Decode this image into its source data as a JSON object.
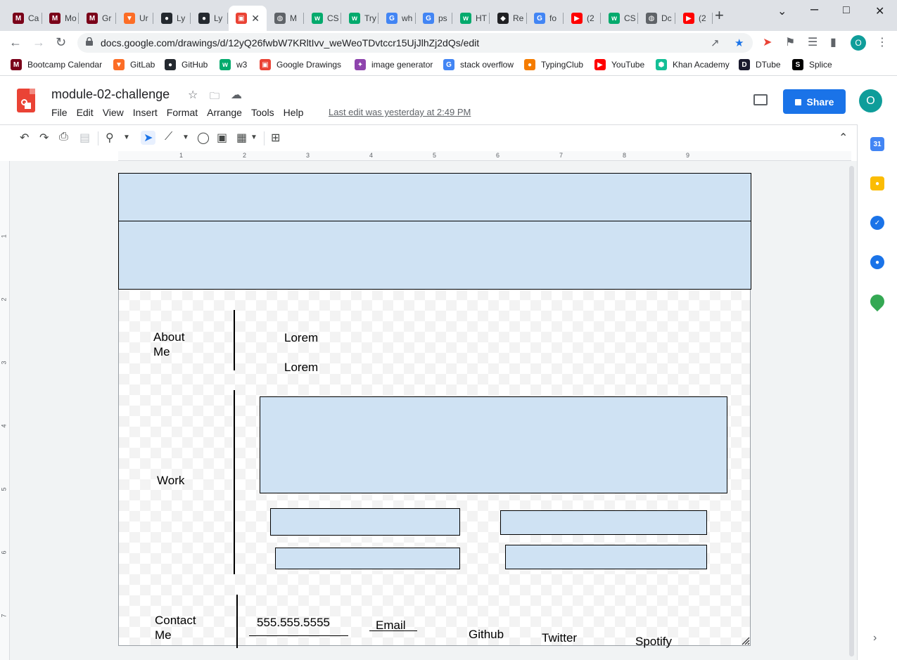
{
  "browser": {
    "tabs": [
      {
        "label": "Ca",
        "icon": "umn-icon",
        "color": "#7a0019",
        "glyph": "M"
      },
      {
        "label": "Mo",
        "icon": "umn-icon",
        "color": "#7a0019",
        "glyph": "M"
      },
      {
        "label": "Gr",
        "icon": "umn-icon",
        "color": "#7a0019",
        "glyph": "M"
      },
      {
        "label": "Ur",
        "icon": "gitlab-icon",
        "color": "#fc6d26",
        "glyph": "▼"
      },
      {
        "label": "Ly",
        "icon": "github-icon",
        "color": "#24292f",
        "glyph": "●"
      },
      {
        "label": "Ly",
        "icon": "github-icon",
        "color": "#24292f",
        "glyph": "●"
      },
      {
        "label": "",
        "icon": "drawings-icon",
        "color": "#ea4335",
        "glyph": "▣",
        "active": true
      },
      {
        "label": "M",
        "icon": "globe-icon",
        "color": "#5f6368",
        "glyph": "◍"
      },
      {
        "label": "CS",
        "icon": "w3-icon",
        "color": "#04aa6d",
        "glyph": "w"
      },
      {
        "label": "Try",
        "icon": "w3-icon",
        "color": "#04aa6d",
        "glyph": "w"
      },
      {
        "label": "wh",
        "icon": "google-icon",
        "color": "#4285f4",
        "glyph": "G"
      },
      {
        "label": "ps",
        "icon": "google-icon",
        "color": "#4285f4",
        "glyph": "G"
      },
      {
        "label": "HT",
        "icon": "w3-icon",
        "color": "#04aa6d",
        "glyph": "w"
      },
      {
        "label": "Re",
        "icon": "replit-icon",
        "color": "#202124",
        "glyph": "◆"
      },
      {
        "label": "fo",
        "icon": "google-icon",
        "color": "#4285f4",
        "glyph": "G"
      },
      {
        "label": "(2",
        "icon": "youtube-icon",
        "color": "#ff0000",
        "glyph": "▶"
      },
      {
        "label": "CS",
        "icon": "w3-icon",
        "color": "#04aa6d",
        "glyph": "w"
      },
      {
        "label": "Dc",
        "icon": "globe-icon",
        "color": "#5f6368",
        "glyph": "◍"
      },
      {
        "label": "(2",
        "icon": "youtube-icon",
        "color": "#ff0000",
        "glyph": "▶"
      }
    ],
    "url": "docs.google.com/drawings/d/12yQ26fwbW7KRltIvv_weWeoTDvtccr15UjJlhZj2dQs/edit",
    "bookmarks": [
      {
        "label": "Bootcamp Calendar",
        "icon": "umn-icon",
        "color": "#7a0019",
        "glyph": "M"
      },
      {
        "label": "GitLab",
        "icon": "gitlab-icon",
        "color": "#fc6d26",
        "glyph": "▼"
      },
      {
        "label": "GitHub",
        "icon": "github-icon",
        "color": "#24292f",
        "glyph": "●"
      },
      {
        "label": "w3",
        "icon": "w3-icon",
        "color": "#04aa6d",
        "glyph": "w"
      },
      {
        "label": "Google Drawings",
        "icon": "drawings-icon",
        "color": "#ea4335",
        "glyph": "▣"
      },
      {
        "label": "image generator",
        "icon": "image-generator-icon",
        "color": "#8e44ad",
        "glyph": "✦"
      },
      {
        "label": "stack overflow",
        "icon": "google-icon",
        "color": "#4285f4",
        "glyph": "G"
      },
      {
        "label": "TypingClub",
        "icon": "typingclub-icon",
        "color": "#f57c00",
        "glyph": "●"
      },
      {
        "label": "YouTube",
        "icon": "youtube-icon",
        "color": "#ff0000",
        "glyph": "▶"
      },
      {
        "label": "Khan Academy",
        "icon": "khan-icon",
        "color": "#14bf96",
        "glyph": "⬢"
      },
      {
        "label": "DTube",
        "icon": "dtube-icon",
        "color": "#1a1a2e",
        "glyph": "D"
      },
      {
        "label": "Splice",
        "icon": "splice-icon",
        "color": "#000000",
        "glyph": "S"
      }
    ]
  },
  "app": {
    "title": "module-02-challenge",
    "menu": [
      "File",
      "Edit",
      "View",
      "Insert",
      "Format",
      "Arrange",
      "Tools",
      "Help"
    ],
    "last_edit": "Last edit was yesterday at 2:49 PM",
    "share_label": "Share",
    "avatar_initial": "O",
    "ruler_h": [
      "1",
      "2",
      "3",
      "4",
      "5",
      "6",
      "7",
      "8",
      "9"
    ],
    "ruler_v": [
      "1",
      "2",
      "3",
      "4",
      "5",
      "6",
      "7"
    ]
  },
  "drawing": {
    "about_label": "About\nMe",
    "lorem_1": "Lorem",
    "lorem_2": "Lorem",
    "work_label": "Work",
    "contact_label": "Contact\nMe",
    "phone": "555.555.5555",
    "email": "Email",
    "github": "Github",
    "twitter": "Twitter",
    "spotify": "Spotify"
  },
  "colors": {
    "shape_fill": "#cfe2f3",
    "share_blue": "#1a73e8",
    "avatar_teal": "#0f9d9a"
  }
}
